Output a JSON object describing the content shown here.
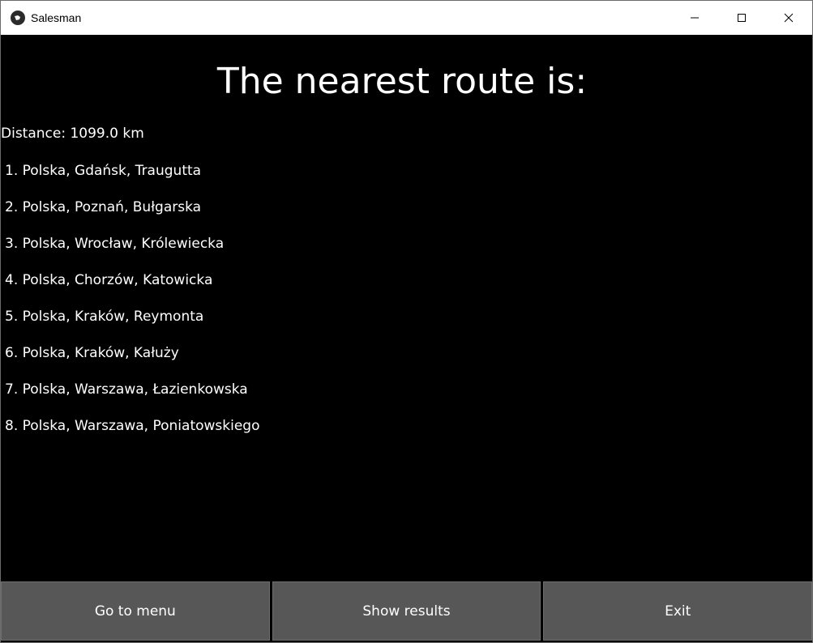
{
  "window": {
    "title": "Salesman",
    "controls": {
      "minimize_icon": "minimize-icon",
      "maximize_icon": "maximize-icon",
      "close_icon": "close-icon"
    }
  },
  "main": {
    "heading": "The nearest route is:",
    "distance": "Distance: 1099.0 km",
    "route": [
      "1. Polska, Gdańsk, Traugutta",
      "2. Polska, Poznań, Bułgarska",
      "3. Polska, Wrocław, Królewiecka",
      "4. Polska, Chorzów, Katowicka",
      "5. Polska, Kraków, Reymonta",
      "6. Polska, Kraków, Kałuży",
      "7. Polska, Warszawa, Łazienkowska",
      "8. Polska, Warszawa, Poniatowskiego"
    ]
  },
  "footer": {
    "menu_label": "Go to menu",
    "results_label": "Show results",
    "exit_label": "Exit"
  },
  "colors": {
    "background": "#000000",
    "text": "#ffffff",
    "button": "#575757",
    "titlebar": "#ffffff"
  }
}
